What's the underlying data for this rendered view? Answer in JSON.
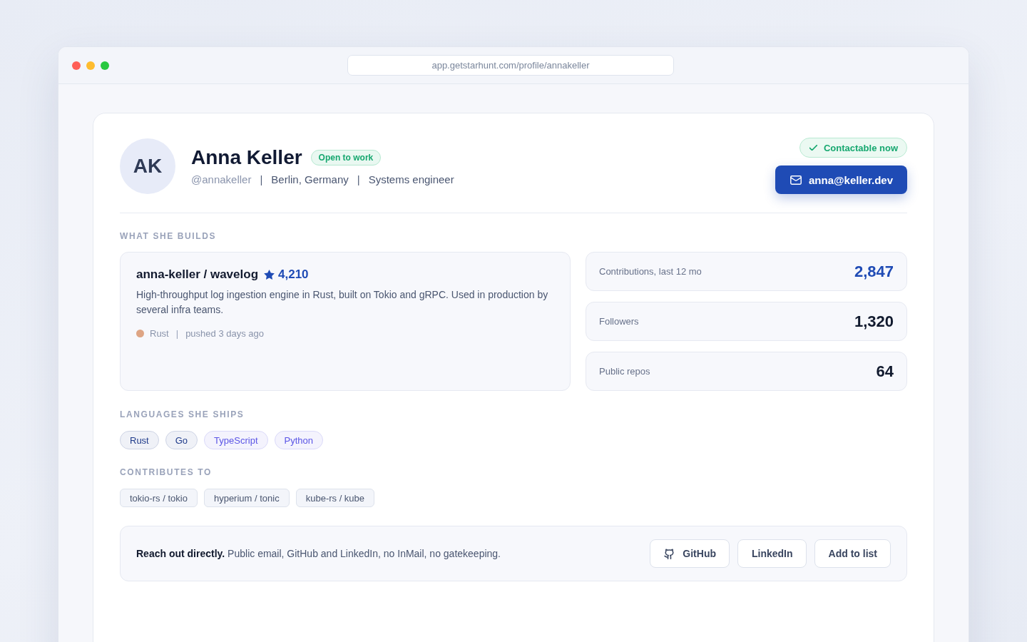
{
  "browser": {
    "url": "app.getstarhunt.com/profile/annakeller"
  },
  "profile": {
    "initials": "AK",
    "name": "Anna Keller",
    "badge": "Open to work",
    "meta": [
      {
        "kind": "handle",
        "text": "@annakeller"
      },
      {
        "kind": "separator",
        "text": "|"
      },
      {
        "kind": "text",
        "text": "Berlin, Germany"
      },
      {
        "kind": "separator",
        "text": "|"
      },
      {
        "kind": "text",
        "text": "Systems engineer"
      }
    ]
  },
  "contact": {
    "status": "Contactable now",
    "email": "anna@keller.dev"
  },
  "builds": {
    "title": "WHAT SHE BUILDS",
    "repo": {
      "title": "anna-keller / wavelog",
      "star_count": "4,210",
      "description": "High-throughput log ingestion engine in Rust, built on Tokio and gRPC. Used in production by several infra teams.",
      "meta": [
        {
          "kind": "language",
          "text": "Rust",
          "color": "#dea584"
        },
        {
          "kind": "separator",
          "text": "|"
        },
        {
          "kind": "text",
          "text": "pushed 3 days ago"
        }
      ]
    },
    "stats": [
      {
        "label": "Contributions, last 12 mo",
        "value": "2,847",
        "highlighted": true
      },
      {
        "label": "Followers",
        "value": "1,320",
        "highlighted": false
      },
      {
        "label": "Public repos",
        "value": "64",
        "highlighted": false
      }
    ]
  },
  "languages": {
    "title": "LANGUAGES SHE SHIPS",
    "items": [
      {
        "label": "Rust",
        "color": "#1e3a8a"
      },
      {
        "label": "Go",
        "color": "#1e3a8a"
      },
      {
        "label": "TypeScript",
        "color": "#5b55e6"
      },
      {
        "label": "Python",
        "color": "#5b55e6"
      }
    ]
  },
  "contributes": {
    "title": "CONTRIBUTES TO",
    "items": [
      "tokio-rs / tokio",
      "hyperium / tonic",
      "kube-rs / kube"
    ]
  },
  "cta": {
    "text": "**Reach out directly.** Public email, GitHub and LinkedIn, no InMail, no gatekeeping.",
    "buttons": [
      {
        "label": "GitHub",
        "kind": "github"
      },
      {
        "label": "LinkedIn",
        "kind": "plain"
      },
      {
        "label": "Add to list",
        "kind": "plain"
      }
    ]
  }
}
